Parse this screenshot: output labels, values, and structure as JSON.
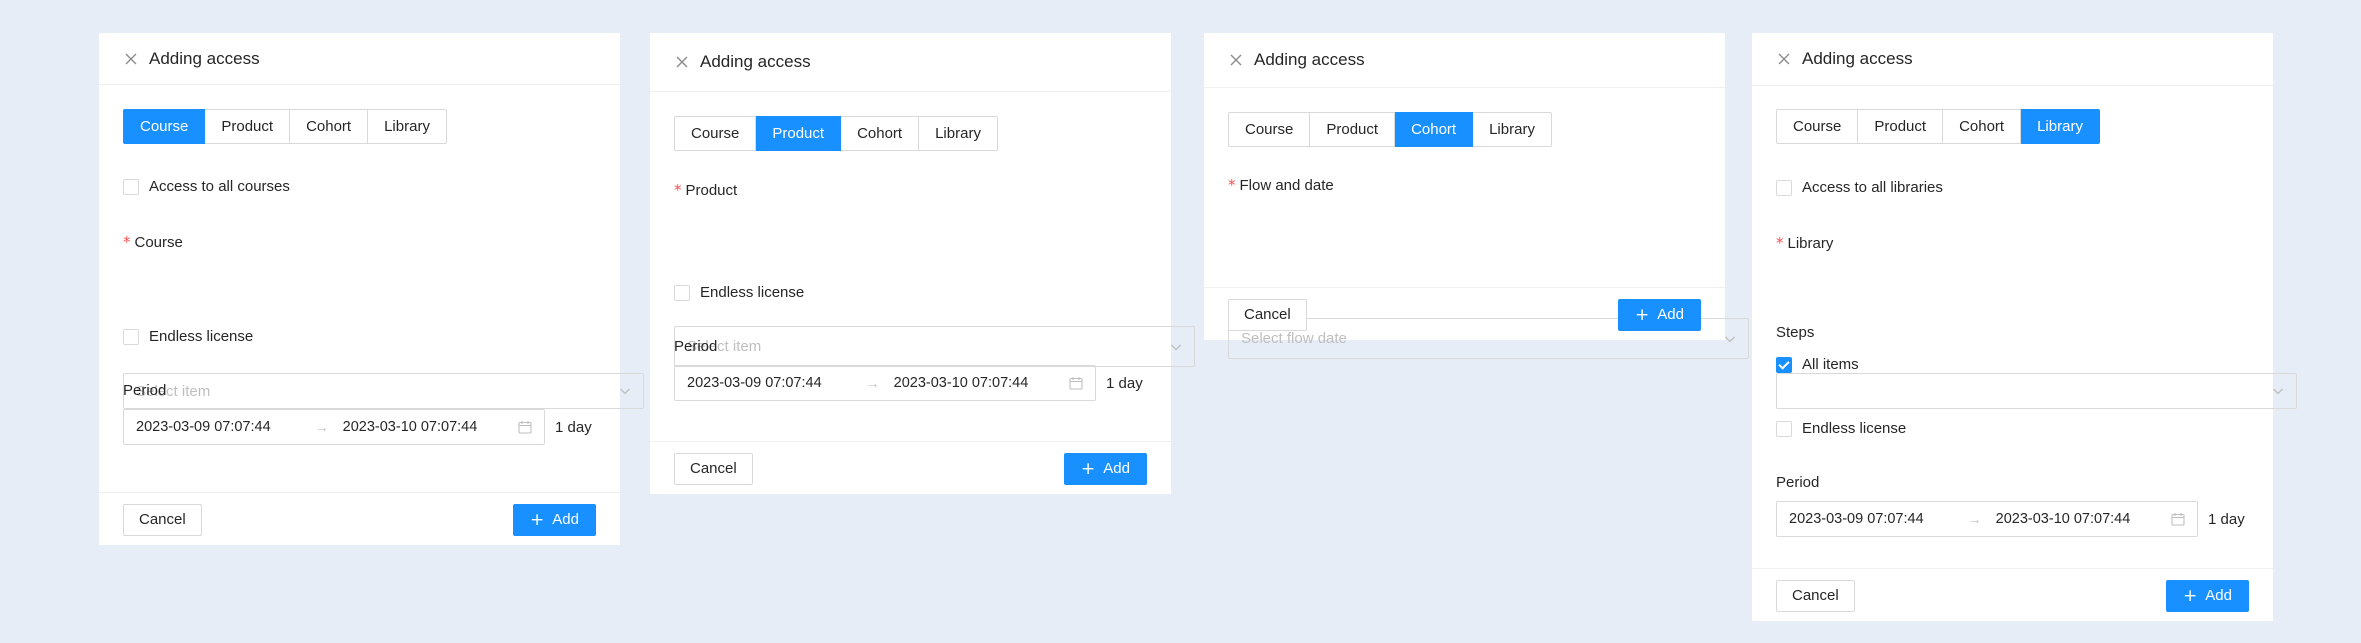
{
  "panels": [
    {
      "title": "Adding access",
      "tabs": [
        "Course",
        "Product",
        "Cohort",
        "Library"
      ],
      "active_tab": 0,
      "all_checkbox_label": "Access to all courses",
      "field_label": "Course",
      "field_placeholder": "Select item",
      "endless_label": "Endless license",
      "period_label": "Period",
      "period_start": "2023-03-09 07:07:44",
      "period_end": "2023-03-10 07:07:44",
      "period_duration": "1 day",
      "cancel_label": "Cancel",
      "add_label": "Add"
    },
    {
      "title": "Adding access",
      "tabs": [
        "Course",
        "Product",
        "Cohort",
        "Library"
      ],
      "active_tab": 1,
      "field_label": "Product",
      "field_placeholder": "Select item",
      "endless_label": "Endless license",
      "period_label": "Period",
      "period_start": "2023-03-09 07:07:44",
      "period_end": "2023-03-10 07:07:44",
      "period_duration": "1 day",
      "cancel_label": "Cancel",
      "add_label": "Add"
    },
    {
      "title": "Adding access",
      "tabs": [
        "Course",
        "Product",
        "Cohort",
        "Library"
      ],
      "active_tab": 2,
      "field_label": "Flow and date",
      "field_placeholder": "Select flow date",
      "cancel_label": "Cancel",
      "add_label": "Add"
    },
    {
      "title": "Adding access",
      "tabs": [
        "Course",
        "Product",
        "Cohort",
        "Library"
      ],
      "active_tab": 3,
      "all_checkbox_label": "Access to all libraries",
      "field_label": "Library",
      "field_placeholder": "",
      "steps_label": "Steps",
      "steps_all_label": "All items",
      "endless_label": "Endless license",
      "period_label": "Period",
      "period_start": "2023-03-09 07:07:44",
      "period_end": "2023-03-10 07:07:44",
      "period_duration": "1 day",
      "cancel_label": "Cancel",
      "add_label": "Add"
    }
  ],
  "colors": {
    "primary": "#1890ff",
    "background": "#e6edf6",
    "required": "#ff4d4f"
  },
  "icons": {
    "close": "close-icon",
    "dropdown": "chevron-down-icon",
    "calendar": "calendar-icon",
    "add": "plus-icon"
  }
}
